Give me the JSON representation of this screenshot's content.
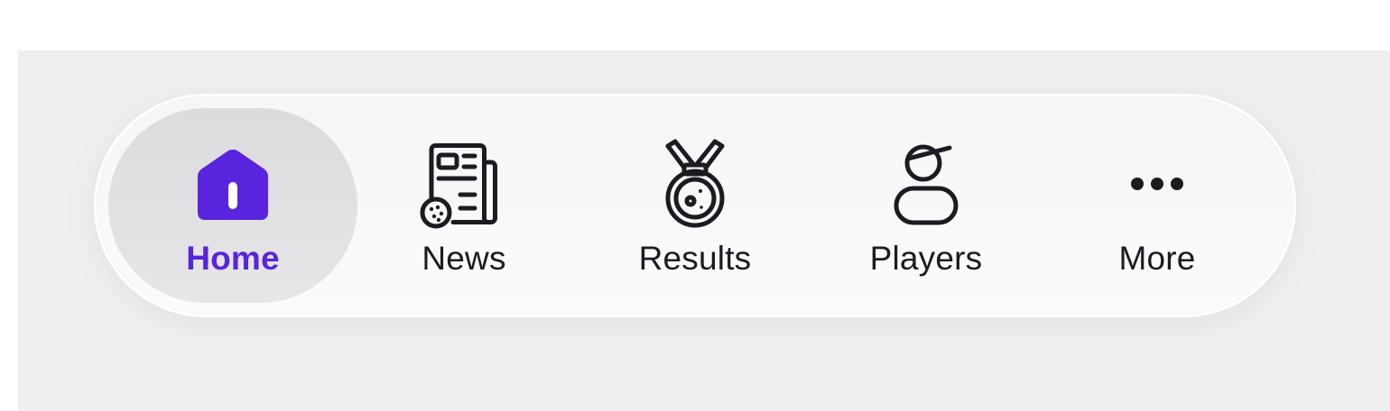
{
  "colors": {
    "accent": "#5a24de",
    "text": "#1b1c22",
    "active_bg": "#e2e2e4",
    "bar_bg": "#f8f8f8",
    "page_bg": "#efefef"
  },
  "tabbar": {
    "active_tab": "Home",
    "tabs": [
      {
        "label": "Home",
        "icon": "home-icon"
      },
      {
        "label": "News",
        "icon": "newspaper-icon"
      },
      {
        "label": "Results",
        "icon": "medal-icon"
      },
      {
        "label": "Players",
        "icon": "player-icon"
      },
      {
        "label": "More",
        "icon": "more-icon"
      }
    ]
  }
}
